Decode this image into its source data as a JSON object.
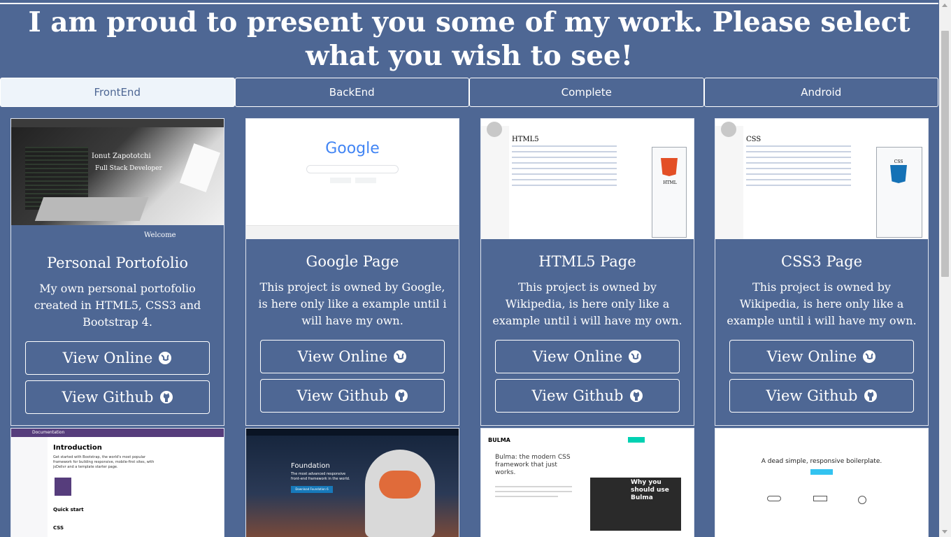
{
  "headline": "I am proud to present you some of my work. Please select what you wish to see!",
  "tabs": [
    "FrontEnd",
    "BackEnd",
    "Complete",
    "Android"
  ],
  "active_tab": "FrontEnd",
  "cards": [
    {
      "title": "Personal Portofolio",
      "description": "My own personal portofolio created in HTML5, CSS3 and Bootstrap 4.",
      "online_label": "View Online",
      "github_label": "View Github",
      "screenshot": {
        "name": "Ionut Zapototchi",
        "subtitle": "Full Stack Developer",
        "welcome": "Welcome"
      }
    },
    {
      "title": "Google Page",
      "description": "This project is owned by Google, is here only like a example until i will have my own.",
      "online_label": "View Online",
      "github_label": "View Github",
      "screenshot": {
        "logo": "Google"
      }
    },
    {
      "title": "HTML5 Page",
      "description": "This project is owned by Wikipedia, is here only like a example until i will have my own.",
      "online_label": "View Online",
      "github_label": "View Github",
      "screenshot": {
        "heading": "HTML5",
        "badge": "HTML"
      }
    },
    {
      "title": "CSS3 Page",
      "description": "This project is owned by Wikipedia, is here only like a example until i will have my own.",
      "online_label": "View Online",
      "github_label": "View Github",
      "screenshot": {
        "heading": "CSS",
        "badge": "CSS"
      }
    }
  ],
  "row2": [
    {
      "heading": "Introduction",
      "text": "Get started with Bootstrap, the world's most popular framework for building responsive, mobile-first sites, with jsDelivr and a template starter page.",
      "subheading": "Quick start",
      "subheading2": "CSS",
      "nav_label": "Documentation"
    },
    {
      "heading": "Foundation",
      "text": "The most advanced responsive front-end framework in the world.",
      "button": "Download Foundation 6"
    },
    {
      "logo": "BULMA",
      "heading": "Bulma: the modern CSS framework that just works.",
      "video_caption": "Why you should use Bulma"
    },
    {
      "heading": "A dead simple, responsive boilerplate."
    }
  ],
  "colors": {
    "background": "#4e6794",
    "active_tab": "#eef4fa",
    "border": "#ffffff"
  }
}
